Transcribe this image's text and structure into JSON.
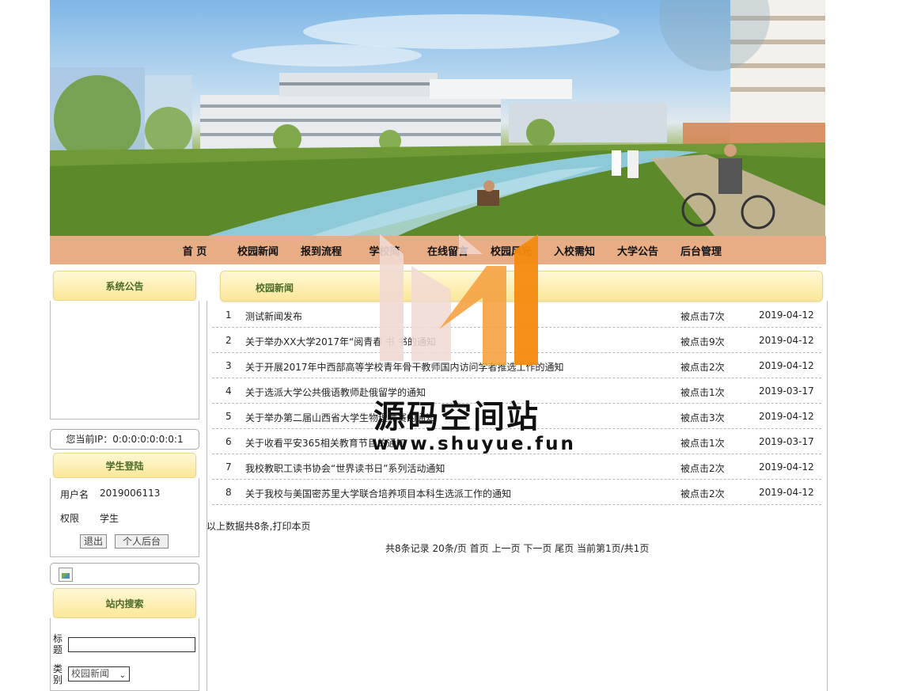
{
  "nav": {
    "items": [
      "首 页",
      "校园新闻",
      "报到流程",
      "学校简",
      "在线留言",
      "校园风光",
      "入校需知",
      "大学公告",
      "后台管理"
    ]
  },
  "sidebar": {
    "announcement_title": "系统公告",
    "ip_text": "您当前IP：0:0:0:0:0:0:0:1",
    "login_title": "学生登陆",
    "username_label": "用户名",
    "username_value": "2019006113",
    "role_label": "权限",
    "role_value": "学生",
    "logout_button": "退出",
    "backend_button": "个人后台",
    "search_title": "站内搜索",
    "search_title_label": "标题",
    "search_category_label": "类别",
    "search_category_value": "校园新闻"
  },
  "news": {
    "section_title": "校园新闻",
    "rows": [
      {
        "num": "1",
        "title": "测试新闻发布",
        "clicks": "被点击7次",
        "date": "2019-04-12"
      },
      {
        "num": "2",
        "title": "关于举办XX大学2017年“阅青春 书 书的通知",
        "clicks": "被点击9次",
        "date": "2019-04-12"
      },
      {
        "num": "3",
        "title": "关于开展2017年中西部高等学校青年骨干教师国内访问学者推选工作的通知",
        "clicks": "被点击2次",
        "date": "2019-04-12"
      },
      {
        "num": "4",
        "title": "关于选派大学公共俄语教师赴俄留学的通知",
        "clicks": "被点击1次",
        "date": "2019-03-17"
      },
      {
        "num": "5",
        "title": "关于举办第二届山西省大学生物理竞赛的通知",
        "clicks": "被点击3次",
        "date": "2019-04-12"
      },
      {
        "num": "6",
        "title": "关于收看平安365相关教育节目的通知",
        "clicks": "被点击1次",
        "date": "2019-03-17"
      },
      {
        "num": "7",
        "title": "我校教职工读书协会“世界读书日”系列活动通知",
        "clicks": "被点击2次",
        "date": "2019-04-12"
      },
      {
        "num": "8",
        "title": "关于我校与美国密苏里大学联合培养项目本科生选派工作的通知",
        "clicks": "被点击2次",
        "date": "2019-04-12"
      }
    ],
    "summary": "以上数据共8条,打印本页",
    "pager": {
      "total": "共8条记录",
      "per_page": "20条/页",
      "first": "首页",
      "prev": "上一页",
      "next": "下一页",
      "last": "尾页",
      "current": "当前第1页/共1页"
    }
  },
  "watermark": {
    "title": "源码空间站",
    "url": "www.shuyue.fun",
    "colors": {
      "light": "#f1d9d2",
      "mid": "#f5a241",
      "dark": "#f38a0e"
    }
  }
}
